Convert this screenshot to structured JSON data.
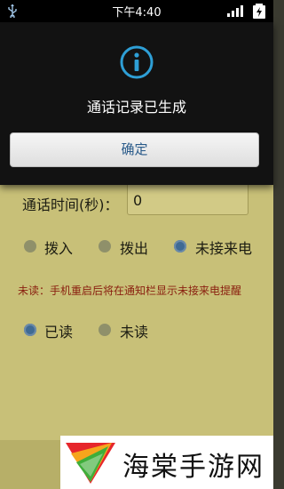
{
  "status_bar": {
    "time": "下午4:40",
    "icons": [
      "usb-icon",
      "signal-icon",
      "battery-icon"
    ]
  },
  "dialog": {
    "icon": "info-icon",
    "message": "通话记录已生成",
    "ok_label": "确定"
  },
  "form": {
    "duration_label": "通话时间(秒)：",
    "duration_value": "0",
    "call_types": [
      {
        "label": "拨入",
        "selected": false
      },
      {
        "label": "拨出",
        "selected": false
      },
      {
        "label": "未接来电",
        "selected": true
      }
    ],
    "notice": "未读：手机重启后将在通知栏显示未接来电提醒",
    "read_states": [
      {
        "label": "已读",
        "selected": true
      },
      {
        "label": "未读",
        "selected": false
      }
    ]
  },
  "watermark": {
    "text": "海棠手游网"
  },
  "colors": {
    "accent": "#2a5b8a",
    "dialog_bg": "#121212",
    "app_bg": "#c8c078",
    "notice": "#8a2010"
  }
}
